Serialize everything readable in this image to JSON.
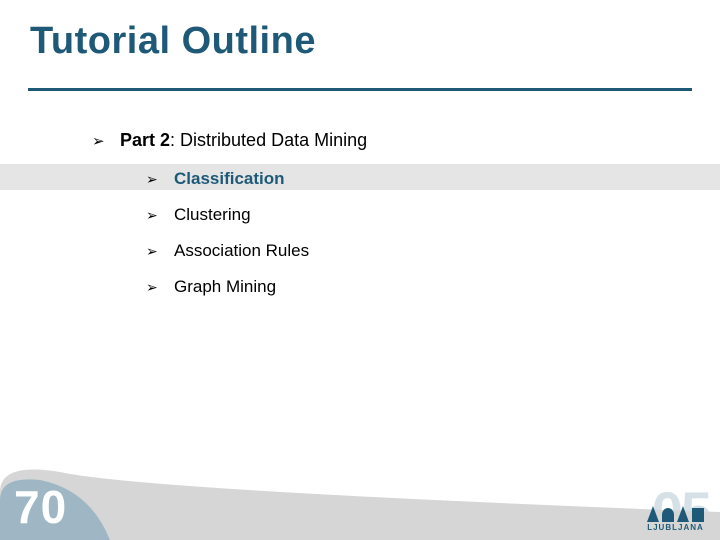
{
  "slide": {
    "title": "Tutorial Outline",
    "page_number": "70",
    "accent_color": "#1e5a78",
    "band_color": "#e5e5e5"
  },
  "outline": {
    "part_label": "Part 2",
    "part_sep": ":  ",
    "part_title": "Distributed Data Mining",
    "items": [
      {
        "label": "Classification",
        "highlighted": true
      },
      {
        "label": "Clustering",
        "highlighted": false
      },
      {
        "label": "Association Rules",
        "highlighted": false
      },
      {
        "label": "Graph Mining",
        "highlighted": false
      }
    ]
  },
  "branding": {
    "watermark": "05",
    "logo_caption": "LJUBLJANA"
  }
}
